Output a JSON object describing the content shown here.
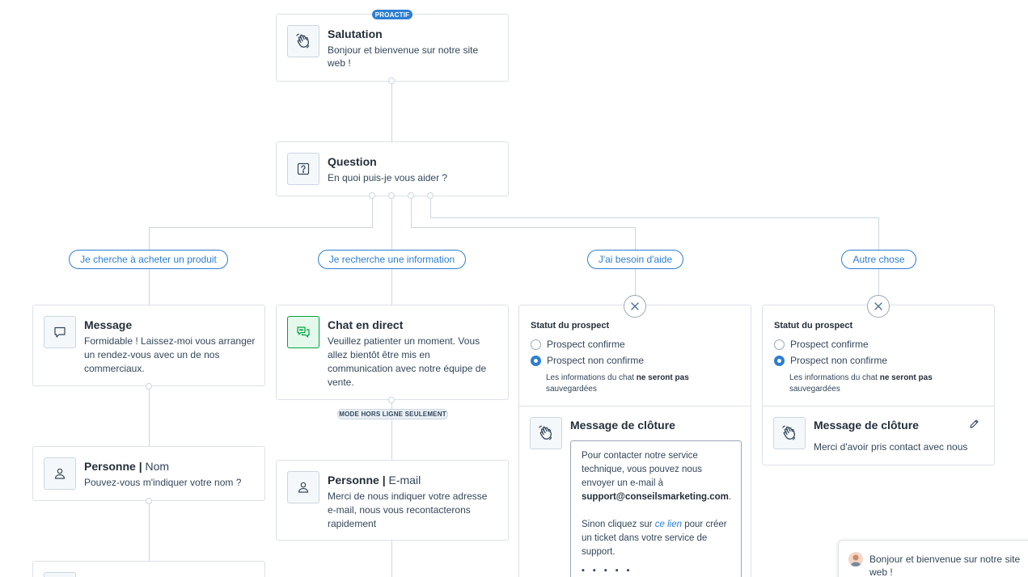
{
  "greeting": {
    "badge": "PROACTIF",
    "title": "Salutation",
    "text": "Bonjour et bienvenue sur notre site web !"
  },
  "question": {
    "title": "Question",
    "text": "En quoi puis-je vous aider ?"
  },
  "branches": [
    {
      "label": "Je cherche à acheter un produit"
    },
    {
      "label": "Je recherche une information"
    },
    {
      "label": "J'ai besoin d'aide"
    },
    {
      "label": "Autre chose"
    }
  ],
  "branch1": {
    "message": {
      "title": "Message",
      "text": "Formidable ! Laissez-moi vous arranger un rendez-vous avec un de nos commerciaux."
    },
    "person": {
      "title": "Personne",
      "separator": "|",
      "field": "Nom",
      "text": "Pouvez-vous m'indiquer votre nom ?"
    }
  },
  "branch2": {
    "chat": {
      "title": "Chat en direct",
      "text": "Veuillez patienter un moment. Vous allez bientôt être mis en communication avec notre équipe de vente."
    },
    "offline_badge": "MODE HORS LIGNE SEULEMENT",
    "person": {
      "title": "Personne",
      "separator": "|",
      "field": "E-mail",
      "text": "Merci de nous indiquer votre adresse e-mail, nous vous recontacterons rapidement"
    }
  },
  "branch3": {
    "status_title": "Statut du prospect",
    "option_confirmed": "Prospect confirme",
    "option_unconfirmed": "Prospect non confirme",
    "selected": "Prospect non confirme",
    "note_prefix": "Les informations du chat ",
    "note_bold": "ne seront pas",
    "note_suffix": "sauvegardées",
    "closing_title": "Message de clôture",
    "editor": {
      "line1": "Pour contacter notre service technique, vous pouvez nous envoyer un e-mail à",
      "email": "support@conseilsmarketing.com",
      "after_email": ".",
      "line2_prefix": "Sinon cliquez sur ",
      "link": "ce lien",
      "line2_suffix": " pour créer un ticket dans votre service de support."
    }
  },
  "branch4": {
    "status_title": "Statut du prospect",
    "option_confirmed": "Prospect confirme",
    "option_unconfirmed": "Prospect non confirme",
    "selected": "Prospect non confirme",
    "note_prefix": "Les informations du chat ",
    "note_bold": "ne seront pas",
    "note_suffix": "sauvegardées",
    "closing_title": "Message de clôture",
    "closing_text": "Merci d'avoir pris contact avec nous"
  },
  "chat_preview": {
    "text": "Bonjour et bienvenue sur notre site web !"
  },
  "icons": {
    "greeting": "wave-hand-icon",
    "question": "question-icon",
    "message": "speech-bubble-icon",
    "chat": "chat-bubbles-icon",
    "person": "person-icon",
    "close": "close-icon",
    "edit": "pencil-icon"
  },
  "colors": {
    "accent": "#2d7ed1",
    "chat_green": "#00a33c",
    "border": "#dbe2ea",
    "text": "#33475b"
  }
}
